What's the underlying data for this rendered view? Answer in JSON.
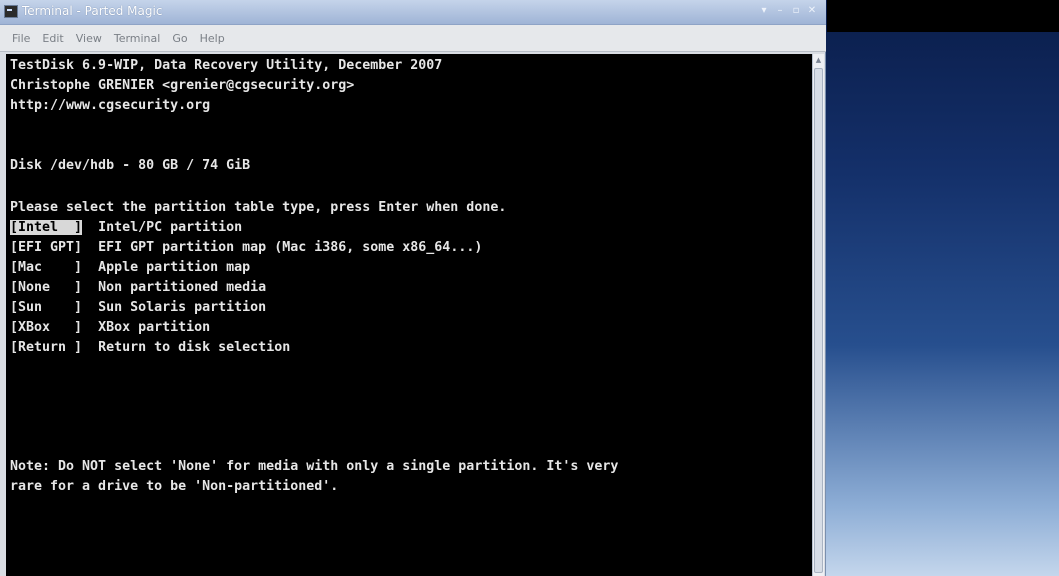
{
  "window": {
    "title": "Terminal - Parted Magic",
    "wm_buttons": [
      "▾",
      "–",
      "▫",
      "✕"
    ]
  },
  "menubar": {
    "items": [
      "File",
      "Edit",
      "View",
      "Terminal",
      "Go",
      "Help"
    ]
  },
  "terminal": {
    "header": [
      "TestDisk 6.9-WIP, Data Recovery Utility, December 2007",
      "Christophe GRENIER <grenier@cgsecurity.org>",
      "http://www.cgsecurity.org"
    ],
    "disk": "Disk /dev/hdb - 80 GB / 74 GiB",
    "prompt": "Please select the partition table type, press Enter when done.",
    "options": [
      {
        "key": "[Intel  ]",
        "desc": "Intel/PC partition",
        "selected": true
      },
      {
        "key": "[EFI GPT]",
        "desc": "EFI GPT partition map (Mac i386, some x86_64...)",
        "selected": false
      },
      {
        "key": "[Mac    ]",
        "desc": "Apple partition map",
        "selected": false
      },
      {
        "key": "[None   ]",
        "desc": "Non partitioned media",
        "selected": false
      },
      {
        "key": "[Sun    ]",
        "desc": "Sun Solaris partition",
        "selected": false
      },
      {
        "key": "[XBox   ]",
        "desc": "XBox partition",
        "selected": false
      },
      {
        "key": "[Return ]",
        "desc": "Return to disk selection",
        "selected": false
      }
    ],
    "note": [
      "Note: Do NOT select 'None' for media with only a single partition. It's very",
      "rare for a drive to be 'Non-partitioned'."
    ]
  },
  "colors": {
    "terminal_bg": "#000000",
    "terminal_fg": "#e6e6e6",
    "selection_bg": "#d8d8d8"
  }
}
